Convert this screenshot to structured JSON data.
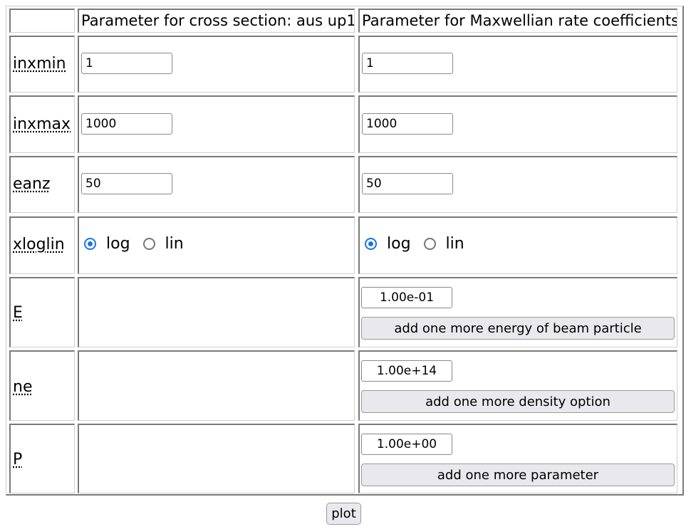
{
  "header": {
    "corner": "",
    "cross_section": "Parameter for cross section: aus up1",
    "maxwellian": "Parameter for Maxwellian rate coefficients:"
  },
  "rows": {
    "inxmin": {
      "label": "inxmin",
      "cross_value": "1",
      "maxwell_value": "1"
    },
    "inxmax": {
      "label": "inxmax",
      "cross_value": "1000",
      "maxwell_value": "1000"
    },
    "eanz": {
      "label": "eanz",
      "cross_value": "50",
      "maxwell_value": "50"
    },
    "xloglin": {
      "label": "xloglin",
      "options": [
        "log",
        "lin"
      ],
      "cross_selected": "log",
      "maxwell_selected": "log"
    },
    "E": {
      "label": "E",
      "value": "1.00e-01",
      "button": "add one more energy of beam particle"
    },
    "ne": {
      "label": "ne",
      "value": "1.00e+14",
      "button": "add one more density option"
    },
    "P": {
      "label": "P",
      "value": "1.00e+00",
      "button": "add one more parameter"
    }
  },
  "plot_button": "plot",
  "colors": {
    "radio_accent": "#1a73e8",
    "button_bg": "#e9e9ed"
  }
}
